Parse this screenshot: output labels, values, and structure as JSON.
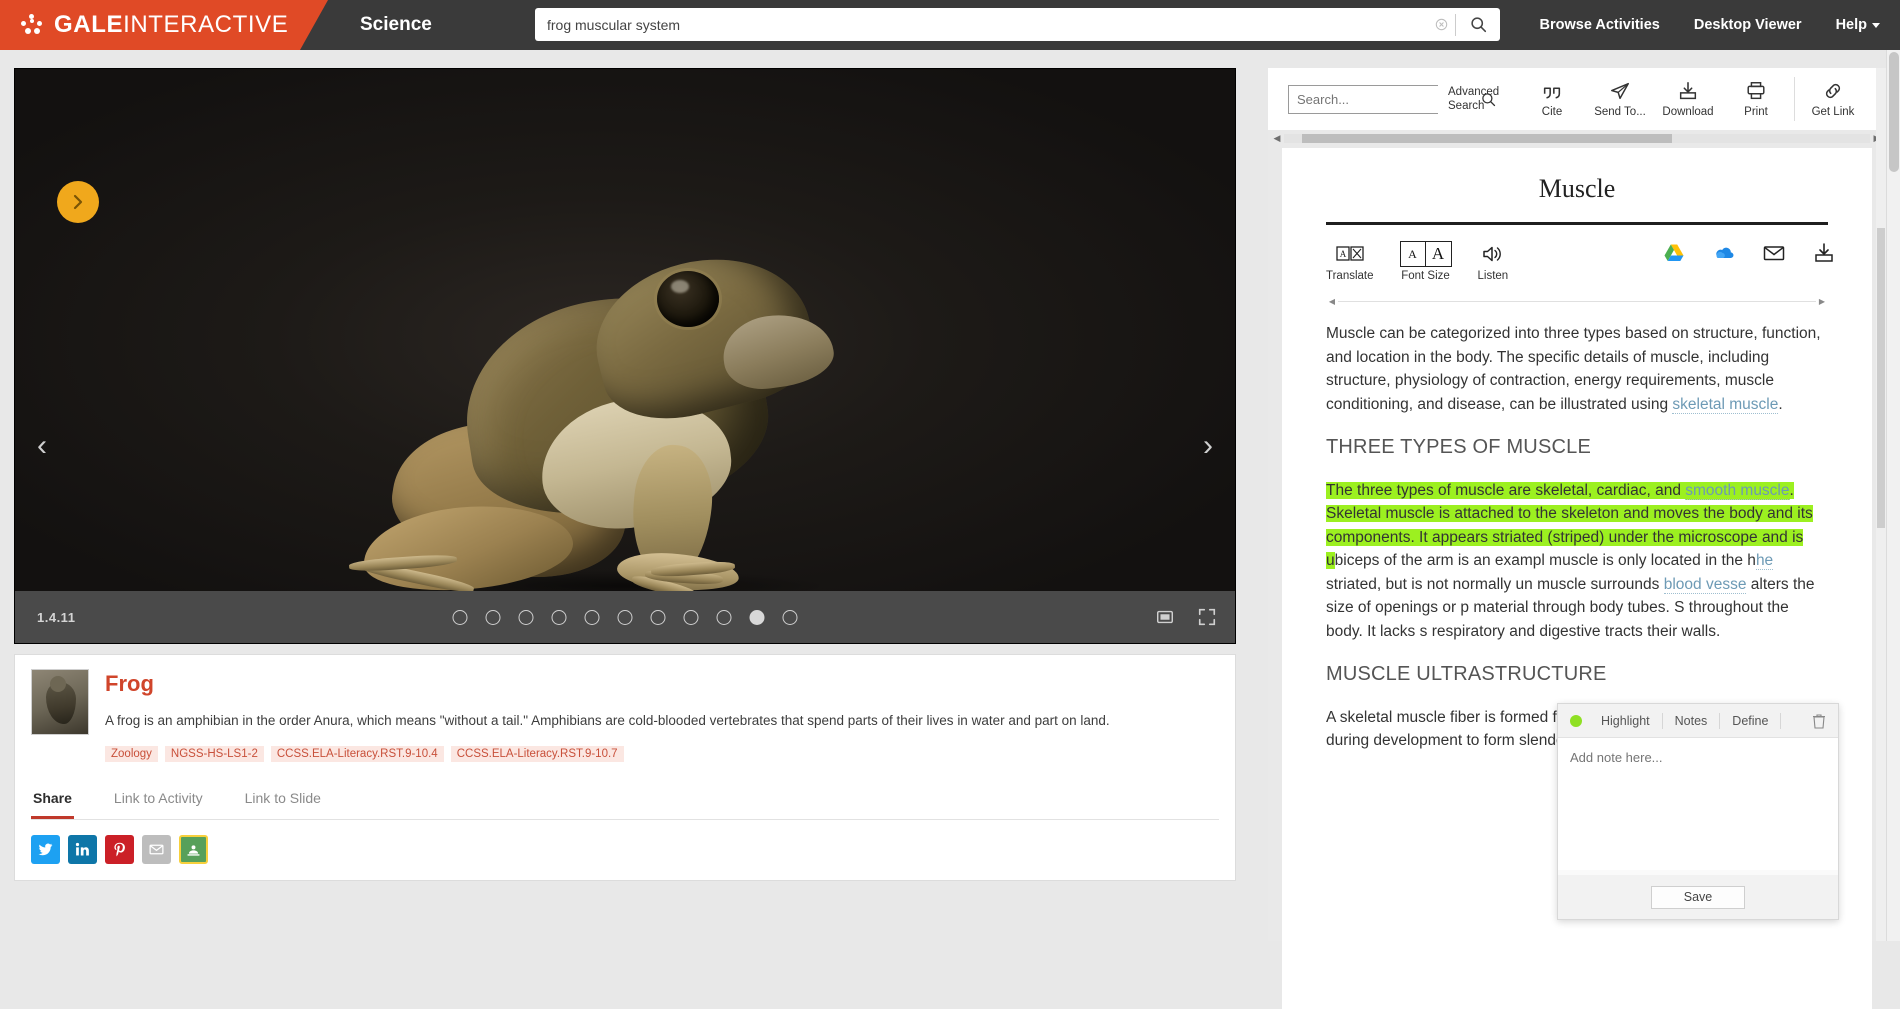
{
  "topbar": {
    "brand_bold": "GALE",
    "brand_light": "INTERACTIVE",
    "section": "Science",
    "search_value": "frog muscular system",
    "search_placeholder": "",
    "nav": [
      {
        "label": "Browse Activities"
      },
      {
        "label": "Desktop Viewer"
      },
      {
        "label": "Help"
      }
    ]
  },
  "viewer": {
    "version": "1.4.11",
    "slide_count": 11,
    "active_slide": 10,
    "expand_title": "Expand",
    "fullscreen_title": "Fullscreen"
  },
  "info_card": {
    "title": "Frog",
    "description": "A frog is an amphibian in the order Anura, which means \"without a tail.\" Amphibians are cold-blooded vertebrates that spend parts of their lives in water and part on land.",
    "tags": [
      "Zoology",
      "NGSS-HS-LS1-2",
      "CCSS.ELA-Literacy.RST.9-10.4",
      "CCSS.ELA-Literacy.RST.9-10.7"
    ],
    "tabs": [
      {
        "label": "Share",
        "active": true
      },
      {
        "label": "Link to Activity",
        "active": false
      },
      {
        "label": "Link to Slide",
        "active": false
      }
    ],
    "socials": [
      {
        "name": "twitter"
      },
      {
        "name": "linkedin"
      },
      {
        "name": "pinterest"
      },
      {
        "name": "email"
      },
      {
        "name": "google-classroom"
      }
    ]
  },
  "doc_toolbar": {
    "search_placeholder": "Search...",
    "advanced_search": "Advanced Search",
    "items": [
      {
        "label": "Cite",
        "icon": "quote-icon"
      },
      {
        "label": "Send To...",
        "icon": "send-icon"
      },
      {
        "label": "Download",
        "icon": "download-icon"
      },
      {
        "label": "Print",
        "icon": "print-icon"
      },
      {
        "label": "Get Link",
        "icon": "link-icon"
      }
    ]
  },
  "document": {
    "title": "Muscle",
    "tools": [
      {
        "label": "Translate",
        "icon": "translate-icon"
      },
      {
        "label": "Font Size",
        "icon": "font-size-icon",
        "small_a": "A",
        "large_a": "A"
      },
      {
        "label": "Listen",
        "icon": "speaker-icon"
      }
    ],
    "share_icons": [
      {
        "name": "google-drive-icon"
      },
      {
        "name": "onedrive-icon"
      },
      {
        "name": "email-icon"
      },
      {
        "name": "download-icon"
      }
    ],
    "paragraph_1_a": "Muscle can be categorized into three types based on structure, function, and location in the body. The specific details of muscle, including structure, physiology of contraction, energy requirements, muscle conditioning, and disease, can be illustrated using ",
    "paragraph_1_link": "skeletal muscle",
    "paragraph_1_b": ".",
    "heading_1": "THREE TYPES OF MUSCLE",
    "p2_s1": "The three types of muscle are skeletal, cardiac, and ",
    "p2_link1": "smooth muscle",
    "p2_s2": ". Skeletal muscle is attached to the skeleton and moves the body and its components. It appears striated (striped) under the microscope and is u",
    "p2_s3": "biceps of the arm is an exampl",
    "p2_s4": "muscle is only located in the h",
    "p2_link2": "he",
    "p2_s5": "striated, but is not normally un",
    "p2_s6": "muscle surrounds ",
    "p2_link3": "blood vesse",
    "p2_s7": "alters the size of openings or p",
    "p2_s8": "material through body tubes. S",
    "p2_s9": "throughout the body. It lacks s",
    "p2_s10": "respiratory and digestive tracts",
    "p2_s11": "their walls.",
    "heading_2": "MUSCLE ULTRASTRUCTURE",
    "p3": "A skeletal muscle fiber is formed from the fusion of many embryonic cells during development to form slender cells that"
  },
  "note_popup": {
    "highlight_label": "Highlight",
    "notes_label": "Notes",
    "define_label": "Define",
    "delete_title": "Delete",
    "note_placeholder": "Add note here...",
    "note_value": "",
    "save_label": "Save",
    "highlight_color": "#8fe023"
  },
  "colors": {
    "brand_orange": "#e04a26",
    "topbar_dark": "#3a3a3a",
    "accent_red": "#d0452b",
    "highlight_green": "#9cf020",
    "link_blue": "#6d9ab5"
  }
}
